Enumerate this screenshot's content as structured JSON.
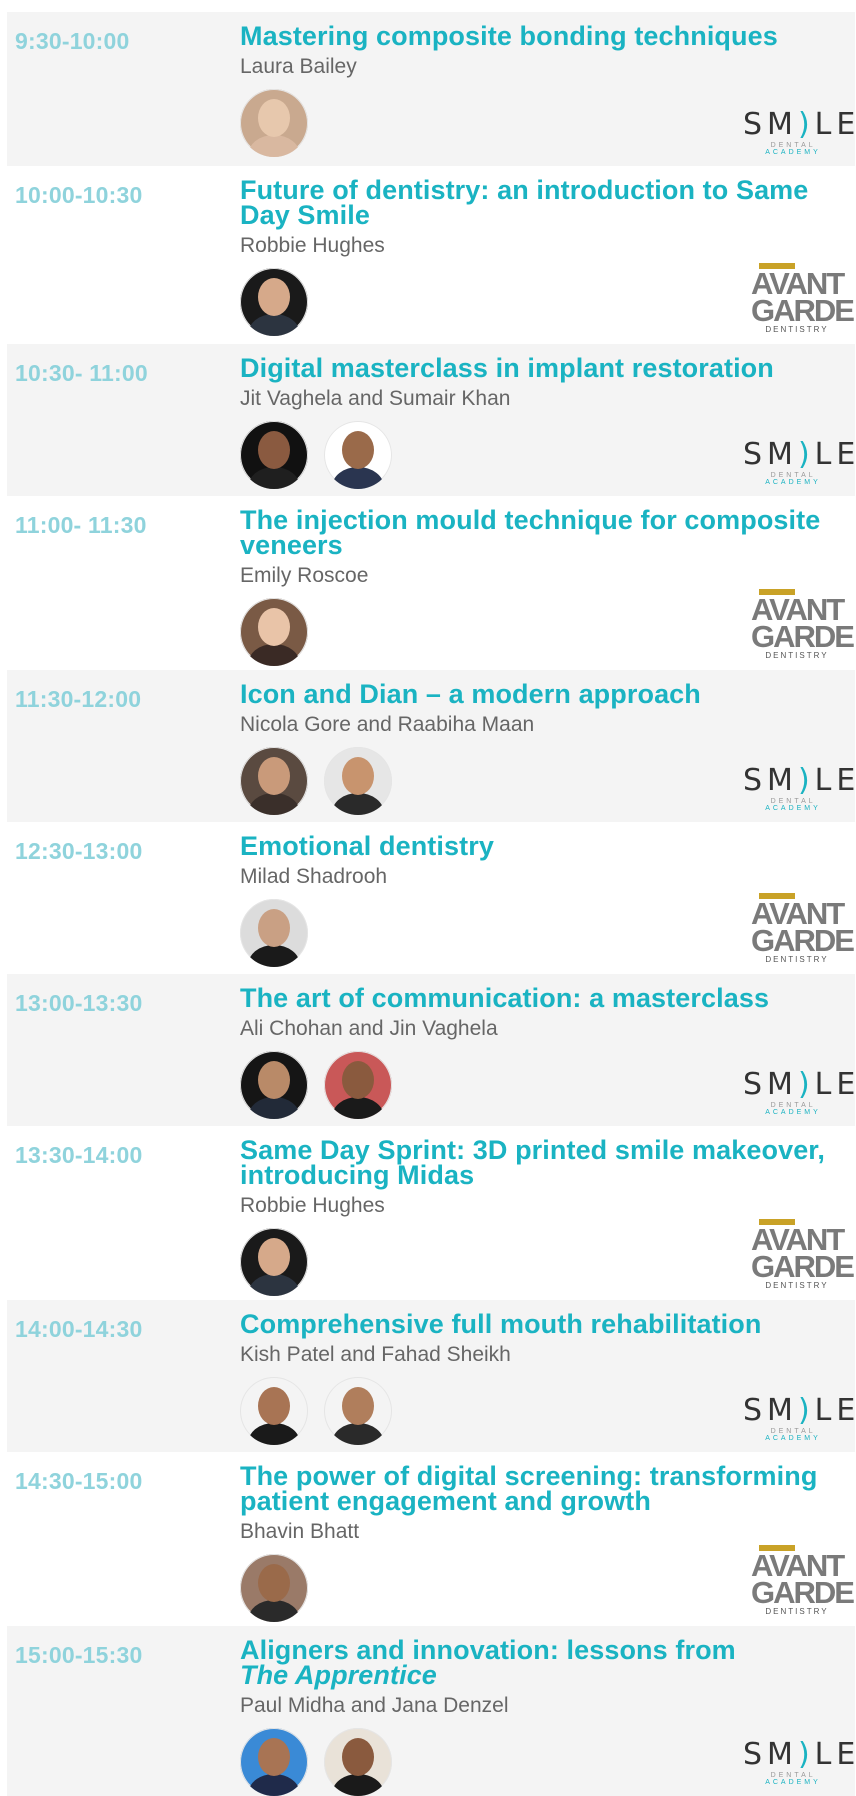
{
  "sessions": [
    {
      "time": "9:30-10:00",
      "title": "Mastering composite bonding techniques",
      "title_em": "",
      "speaker": "Laura Bailey",
      "avatars": [
        {
          "name": "Laura Bailey",
          "bg": "#c9a98f",
          "head": "#e7c8ad",
          "body": "#d9b8a0"
        }
      ],
      "logo": "smile"
    },
    {
      "time": "10:00-10:30",
      "title": "Future of dentistry: an introduction to Same Day Smile",
      "title_em": "",
      "speaker": "Robbie Hughes",
      "avatars": [
        {
          "name": "Robbie Hughes",
          "bg": "#1a1a1a",
          "head": "#d6a98a",
          "body": "#2c3440"
        }
      ],
      "logo": "avant"
    },
    {
      "time": "10:30- 11:00",
      "title": "Digital masterclass in implant restoration",
      "title_em": "",
      "speaker": "Jit Vaghela and Sumair Khan",
      "avatars": [
        {
          "name": "Jit Vaghela",
          "bg": "#111111",
          "head": "#8a5a40",
          "body": "#1f1f1f"
        },
        {
          "name": "Sumair Khan",
          "bg": "#ffffff",
          "head": "#9a6a4a",
          "body": "#2a3550"
        }
      ],
      "logo": "smile"
    },
    {
      "time": "11:00- 11:30",
      "title": "The injection mould technique for composite veneers",
      "title_em": "",
      "speaker": "Emily Roscoe",
      "avatars": [
        {
          "name": "Emily Roscoe",
          "bg": "#7a5a45",
          "head": "#e9c4a8",
          "body": "#3a2a25"
        }
      ],
      "logo": "avant"
    },
    {
      "time": "11:30-12:00",
      "title": "Icon and Dian – a modern approach",
      "title_em": "",
      "speaker": "Nicola Gore and Raabiha Maan",
      "avatars": [
        {
          "name": "Nicola Gore",
          "bg": "#5a4a40",
          "head": "#c99a7a",
          "body": "#3a2f2a"
        },
        {
          "name": "Raabiha Maan",
          "bg": "#e6e6e6",
          "head": "#c8946e",
          "body": "#2a2a2a"
        }
      ],
      "logo": "smile"
    },
    {
      "time": "12:30-13:00",
      "title": "Emotional dentistry",
      "title_em": "",
      "speaker": "Milad Shadrooh",
      "avatars": [
        {
          "name": "Milad Shadrooh",
          "bg": "#dcdcdc",
          "head": "#c9a084",
          "body": "#1a1a1a"
        }
      ],
      "logo": "avant"
    },
    {
      "time": "13:00-13:30",
      "title": "The art of communication: a masterclass",
      "title_em": "",
      "speaker": "Ali Chohan and Jin Vaghela",
      "avatars": [
        {
          "name": "Ali Chohan",
          "bg": "#151515",
          "head": "#b98a68",
          "body": "#222a38"
        },
        {
          "name": "Jin Vaghela",
          "bg": "#c95858",
          "head": "#8a5a3e",
          "body": "#1a1a1a"
        }
      ],
      "logo": "smile"
    },
    {
      "time": "13:30-14:00",
      "title": "Same Day Sprint: 3D printed smile makeover, introducing Midas",
      "title_em": "",
      "speaker": "Robbie Hughes",
      "avatars": [
        {
          "name": "Robbie Hughes",
          "bg": "#1a1a1a",
          "head": "#d6a98a",
          "body": "#2c3440"
        }
      ],
      "logo": "avant"
    },
    {
      "time": "14:00-14:30",
      "title": "Comprehensive full mouth rehabilitation",
      "title_em": "",
      "speaker": "Kish Patel and Fahad Sheikh",
      "avatars": [
        {
          "name": "Kish Patel",
          "bg": "#f4f4f4",
          "head": "#a87454",
          "body": "#1a1a1a"
        },
        {
          "name": "Fahad Sheikh",
          "bg": "#f4f4f4",
          "head": "#b07e5c",
          "body": "#2a2a2a"
        }
      ],
      "logo": "smile"
    },
    {
      "time": "14:30-15:00",
      "title": "The power of digital screening: transforming patient engagement and growth",
      "title_em": "",
      "speaker": "Bhavin Bhatt",
      "avatars": [
        {
          "name": "Bhavin Bhatt",
          "bg": "#9a7a68",
          "head": "#9a6a4a",
          "body": "#2a2a2a"
        }
      ],
      "logo": "avant"
    },
    {
      "time": "15:00-15:30",
      "title": "Aligners and innovation: lessons from",
      "title_em": "The Apprentice",
      "speaker": "Paul Midha and Jana Denzel",
      "avatars": [
        {
          "name": "Paul Midha",
          "bg": "#3a8ad6",
          "head": "#a87454",
          "body": "#1f2a4a"
        },
        {
          "name": "Jana Denzel",
          "bg": "#e9e2d8",
          "head": "#8a5a3e",
          "body": "#1a1a1a"
        }
      ],
      "logo": "smile"
    }
  ],
  "logos": {
    "smile": {
      "wordmark_left": "SM",
      "wordmark_paren": ")",
      "wordmark_right": "LE",
      "sub_left": "DENTAL",
      "sub_right": "ACADEMY"
    },
    "avant": {
      "w1": "AVANT",
      "w2": "GARDE",
      "w3": "DENTISTRY"
    }
  }
}
